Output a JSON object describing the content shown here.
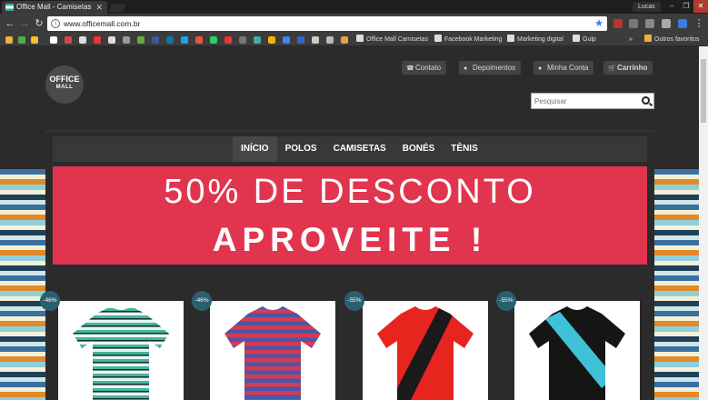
{
  "browser": {
    "tab_title": "Office Mall - Camisetas",
    "url": "www.officemall.com.br",
    "user": "Lucas",
    "window_controls": [
      "minimize-icon",
      "maximize-icon",
      "close-icon"
    ],
    "bookmarks": [
      {
        "label": "Office Mall Camisetas"
      },
      {
        "label": "Facebook Marketing"
      },
      {
        "label": "Marketing digital"
      },
      {
        "label": "Gulp"
      },
      {
        "label": "Outros favoritos"
      }
    ],
    "overflow": "»"
  },
  "site": {
    "logo_top": "OFFICE",
    "logo_bottom": "MALL",
    "top_links": [
      {
        "label": "Contato",
        "icon": "phone-icon"
      },
      {
        "label": "Depoimentos",
        "icon": "chat-icon"
      },
      {
        "label": "Minha Conta",
        "icon": "user-icon"
      },
      {
        "label": "Carrinho",
        "icon": "cart-icon"
      }
    ],
    "search_placeholder": "Pesquisar",
    "nav": [
      "INÍCIO",
      "POLOS",
      "CAMISETAS",
      "BONÉS",
      "TÊNIS"
    ],
    "banner": {
      "line1": "50% DE DESCONTO",
      "line2": "APROVEITE !",
      "color": "#e1354f"
    },
    "products": [
      {
        "discount": "-46%",
        "shirt": "green-white striped t-shirt"
      },
      {
        "discount": "-46%",
        "shirt": "red-blue striped t-shirt"
      },
      {
        "discount": "-55%",
        "shirt": "red t-shirt with black diagonal sash"
      },
      {
        "discount": "-55%",
        "shirt": "black t-shirt with turquoise diagonal sash"
      }
    ]
  }
}
